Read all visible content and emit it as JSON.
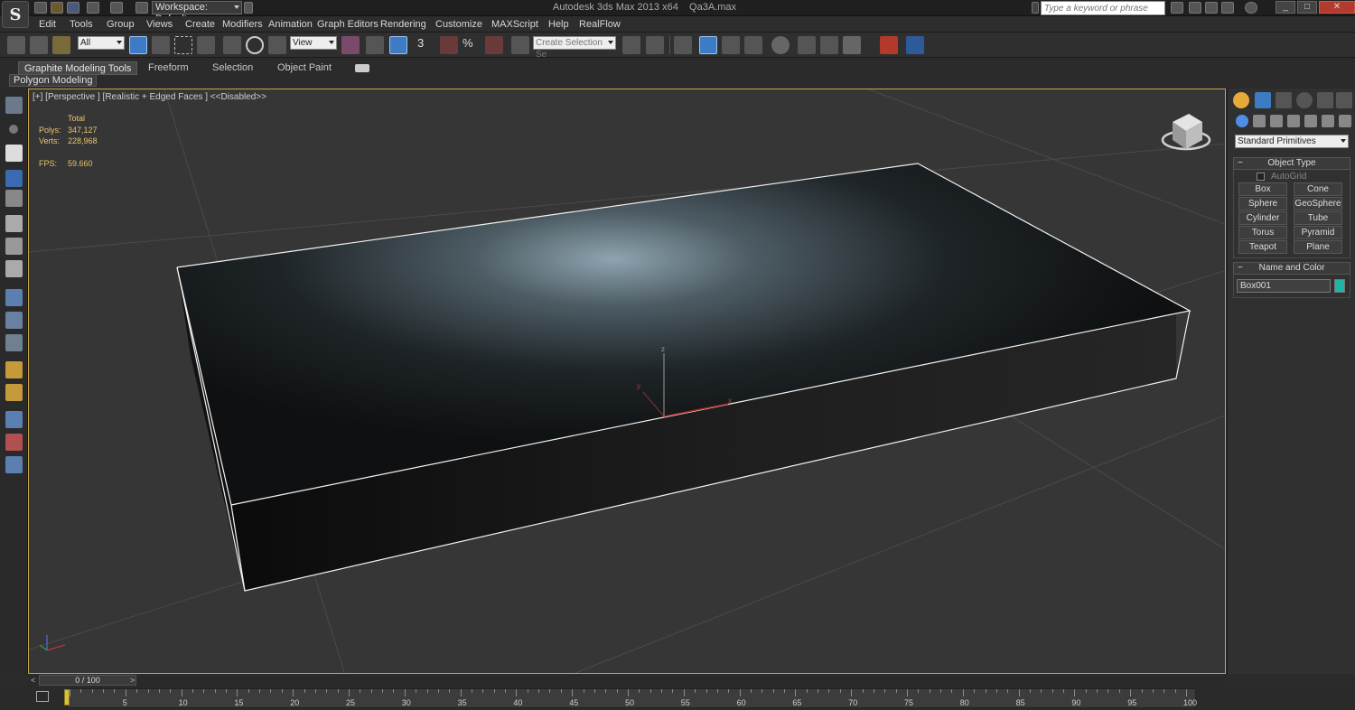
{
  "title_bar": {
    "workspace_label": "Workspace: Default",
    "app_title": "Autodesk 3ds Max  2013 x64",
    "file_name": "Qa3A.max",
    "search_placeholder": "Type a keyword or phrase"
  },
  "menu": {
    "items": [
      "Edit",
      "Tools",
      "Group",
      "Views",
      "Create",
      "Modifiers",
      "Animation",
      "Graph Editors",
      "Rendering",
      "Customize",
      "MAXScript",
      "Help",
      "RealFlow"
    ]
  },
  "toolbar": {
    "selection_filter": "All",
    "reference_coord": "View",
    "selection_set": "Create Selection Se",
    "snap_label": "3",
    "percent_label": "%"
  },
  "ribbon": {
    "tabs": [
      "Graphite Modeling Tools",
      "Freeform",
      "Selection",
      "Object Paint"
    ],
    "panel_label": "Polygon Modeling"
  },
  "viewport": {
    "label": "[+] [Perspective ] [Realistic + Edged Faces ]  <<Disabled>>",
    "stats": {
      "total_label": "Total",
      "polys_label": "Polys:",
      "polys_value": "347,127",
      "verts_label": "Verts:",
      "verts_value": "228,968",
      "fps_label": "FPS:",
      "fps_value": "59.660"
    },
    "gizmo_x": "x",
    "gizmo_y": "y",
    "gizmo_z": "z",
    "border_color": "#c9a64a"
  },
  "command_panel": {
    "primitives_dropdown": "Standard Primitives",
    "object_type_title": "Object Type",
    "autogrid_label": "AutoGrid",
    "buttons": [
      "Box",
      "Cone",
      "Sphere",
      "GeoSphere",
      "Cylinder",
      "Tube",
      "Torus",
      "Pyramid",
      "Teapot",
      "Plane"
    ],
    "name_color_title": "Name and Color",
    "object_name": "Box001",
    "object_color": "#1fb5a6"
  },
  "timeline": {
    "frame_display": "0 / 100",
    "prev_arrow": "<",
    "next_arrow": ">",
    "ticks": [
      "5",
      "10",
      "15",
      "20",
      "25",
      "30",
      "35",
      "40",
      "45",
      "50",
      "55",
      "60",
      "65",
      "70",
      "75",
      "80",
      "85",
      "90",
      "95",
      "100"
    ]
  }
}
